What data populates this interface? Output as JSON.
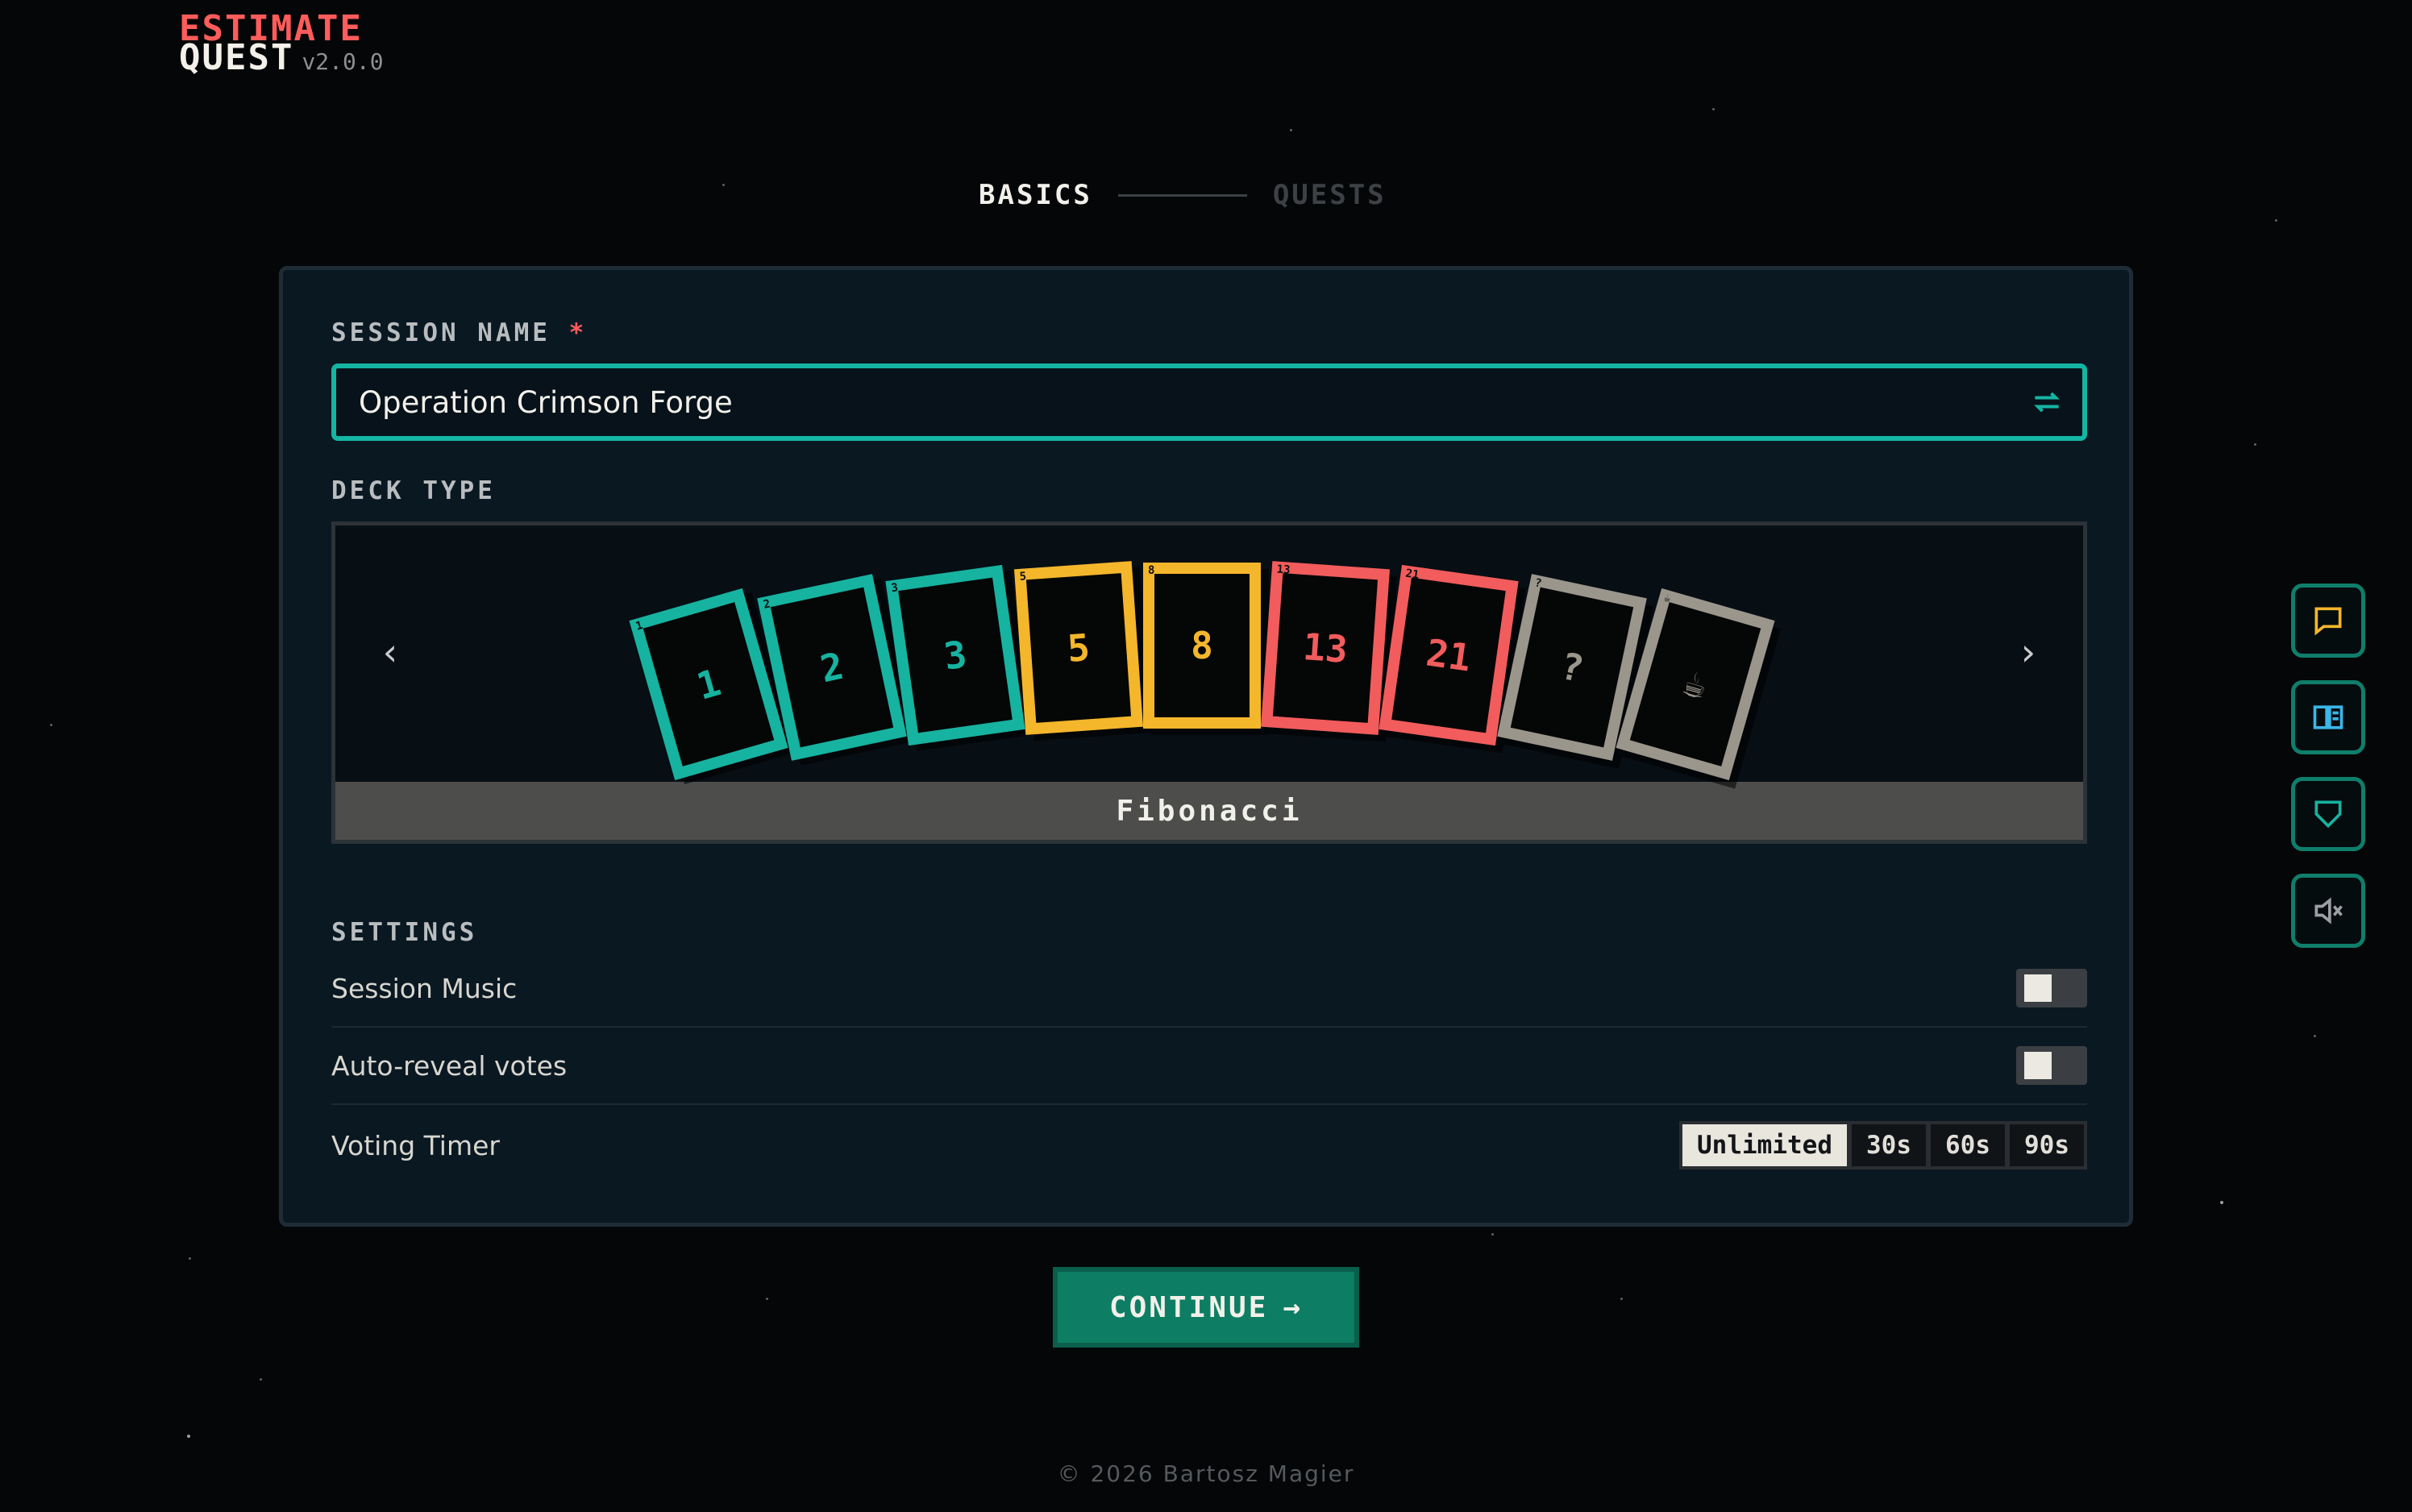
{
  "logo": {
    "line1": "ESTIMATE",
    "line2": "QUEST",
    "version": "v2.0.0"
  },
  "stepper": {
    "step1": "BASICS",
    "step2": "QUESTS"
  },
  "session_name": {
    "label": "SESSION NAME",
    "required_mark": "*",
    "value": "Operation Crimson Forge",
    "shuffle_icon": "shuffle-icon"
  },
  "deck": {
    "label": "DECK TYPE",
    "name": "Fibonacci",
    "prev": "‹",
    "next": "›",
    "cards": [
      {
        "value": "1",
        "color": "#16b3a0"
      },
      {
        "value": "2",
        "color": "#16b3a0"
      },
      {
        "value": "3",
        "color": "#16b3a0"
      },
      {
        "value": "5",
        "color": "#f4b62b"
      },
      {
        "value": "8",
        "color": "#f4b62b"
      },
      {
        "value": "13",
        "color": "#f25c5c"
      },
      {
        "value": "21",
        "color": "#f25c5c"
      },
      {
        "value": "?",
        "color": "#9b968c"
      },
      {
        "value": "☕",
        "color": "#9b968c"
      }
    ]
  },
  "settings": {
    "label": "SETTINGS",
    "music": {
      "label": "Session Music",
      "enabled": false
    },
    "auto_reveal": {
      "label": "Auto-reveal votes",
      "enabled": false
    },
    "timer": {
      "label": "Voting Timer",
      "options": [
        "Unlimited",
        "30s",
        "60s",
        "90s"
      ],
      "selected": "Unlimited"
    }
  },
  "continue_button": {
    "label": "CONTINUE",
    "arrow": "→"
  },
  "footer": "© 2026 Bartosz Magier",
  "side_buttons": [
    "chat-icon",
    "book-icon",
    "shield-icon",
    "mute-icon"
  ],
  "colors": {
    "accent": "#14b5a3",
    "brand_red": "#ff5c5c",
    "button": "#0d7e63"
  }
}
